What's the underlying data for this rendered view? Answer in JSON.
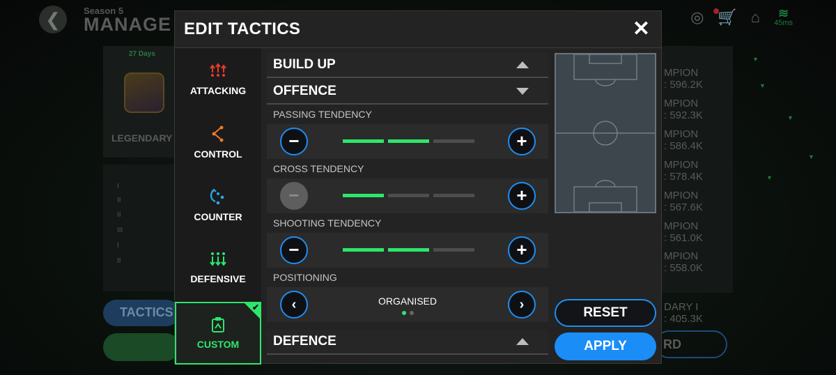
{
  "background": {
    "season": "Season 5",
    "title": "MANAGE",
    "days": "27 Days",
    "league": "LEGENDARY",
    "tactics_button": "TACTICS",
    "right_panel": [
      "MPION",
      "596.2K",
      "MPION",
      "592.3K",
      "MPION",
      "586.4K",
      "MPION",
      "578.4K",
      "MPION",
      "567.6K",
      "MPION",
      "561.0K",
      "MPION",
      "558.0K"
    ],
    "right_bottom": [
      "DARY I",
      ": 405.3K"
    ],
    "right_button": "RD",
    "ping": "45ms",
    "ranks": [
      "I",
      "II",
      "II",
      "III",
      "I",
      "II"
    ]
  },
  "modal": {
    "title": "EDIT TACTICS",
    "close_icon": "close-icon"
  },
  "tabs": [
    {
      "label": "ATTACKING",
      "icon": "attacking-icon",
      "color": "#e83a2c"
    },
    {
      "label": "CONTROL",
      "icon": "control-icon",
      "color": "#f07a28"
    },
    {
      "label": "COUNTER",
      "icon": "counter-icon",
      "color": "#2aa7e8"
    },
    {
      "label": "DEFENSIVE",
      "icon": "defensive-icon",
      "color": "#2ee66b"
    },
    {
      "label": "CUSTOM",
      "icon": "custom-icon",
      "color": "#2ee66b",
      "selected": true
    }
  ],
  "sections": {
    "build_up": {
      "title": "BUILD UP",
      "expanded": false
    },
    "offence": {
      "title": "OFFENCE",
      "expanded": true
    },
    "defence": {
      "title": "DEFENCE",
      "expanded": false
    }
  },
  "offence": {
    "passing": {
      "label": "PASSING TENDENCY",
      "level": 2,
      "max": 3
    },
    "cross": {
      "label": "CROSS TENDENCY",
      "level": 1,
      "max": 3
    },
    "shooting": {
      "label": "SHOOTING TENDENCY",
      "level": 2,
      "max": 3
    },
    "positioning": {
      "label": "POSITIONING",
      "value": "ORGANISED",
      "page": 1,
      "pages": 2
    }
  },
  "buttons": {
    "reset": "RESET",
    "apply": "APPLY"
  },
  "colors": {
    "accent_green": "#2ee66b",
    "accent_blue": "#1f8ef0",
    "apply_blue": "#1a8df7"
  }
}
